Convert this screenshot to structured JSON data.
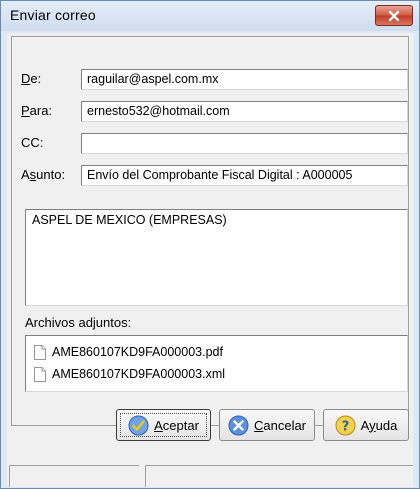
{
  "window": {
    "title": "Enviar correo"
  },
  "labels": {
    "de": "De:",
    "para": "Para:",
    "cc": "CC:",
    "asunto": "Asunto:",
    "attachments": "Archivos adjuntos:"
  },
  "fields": {
    "de": "raguilar@aspel.com.mx",
    "para": "ernesto532@hotmail.com",
    "cc": "",
    "asunto": "Envío del Comprobante Fiscal Digital : A000005",
    "body": "ASPEL DE MEXICO (EMPRESAS)"
  },
  "attachments": [
    "AME860107KD9FA000003.pdf",
    "AME860107KD9FA000003.xml"
  ],
  "buttons": {
    "accept": "Aceptar",
    "cancel": "Cancelar",
    "help": "Ayuda"
  },
  "colors": {
    "title_bg": "#cfddef",
    "close_button": "#c23a25",
    "accept_icon": "#f0c419",
    "cancel_icon": "#2f6fd6",
    "help_icon": "#f0c419"
  },
  "icons": {
    "close": "close-x-icon",
    "accept": "checkmark-icon",
    "cancel": "x-circle-icon",
    "help": "question-icon",
    "file": "document-icon"
  }
}
